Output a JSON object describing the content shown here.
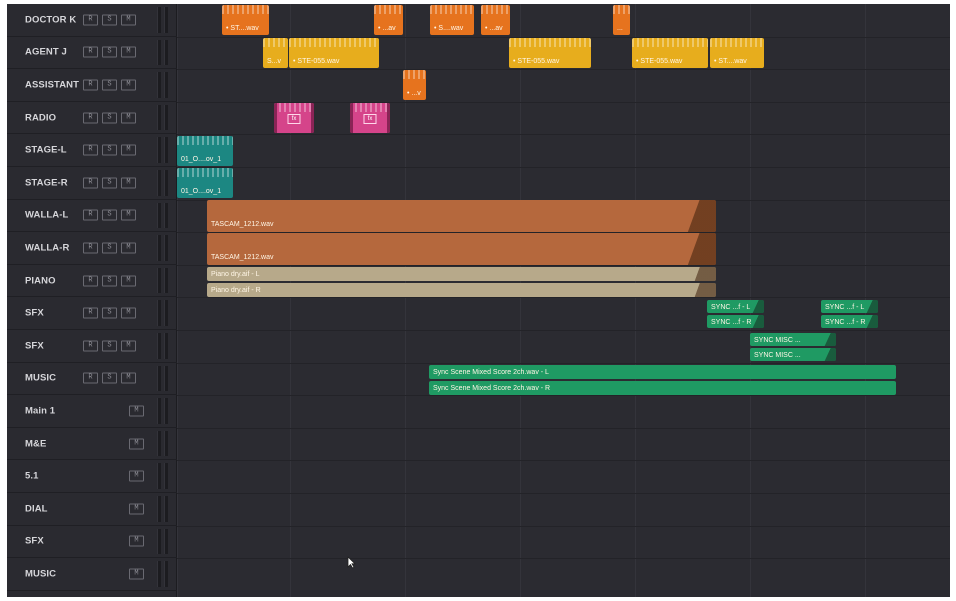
{
  "tracks": [
    {
      "name": "DOCTOR K",
      "buttons": [
        "R",
        "S",
        "M"
      ]
    },
    {
      "name": "AGENT J",
      "buttons": [
        "R",
        "S",
        "M"
      ]
    },
    {
      "name": "ASSISTANT",
      "buttons": [
        "R",
        "S",
        "M"
      ]
    },
    {
      "name": "RADIO",
      "buttons": [
        "R",
        "S",
        "M"
      ]
    },
    {
      "name": "STAGE-L",
      "buttons": [
        "R",
        "S",
        "M"
      ]
    },
    {
      "name": "STAGE-R",
      "buttons": [
        "R",
        "S",
        "M"
      ]
    },
    {
      "name": "WALLA-L",
      "buttons": [
        "R",
        "S",
        "M"
      ]
    },
    {
      "name": "WALLA-R",
      "buttons": [
        "R",
        "S",
        "M"
      ]
    },
    {
      "name": "PIANO",
      "buttons": [
        "R",
        "S",
        "M"
      ]
    },
    {
      "name": "SFX",
      "buttons": [
        "R",
        "S",
        "M"
      ]
    },
    {
      "name": "SFX",
      "buttons": [
        "R",
        "S",
        "M"
      ]
    },
    {
      "name": "MUSIC",
      "buttons": [
        "R",
        "S",
        "M"
      ]
    },
    {
      "name": "Main 1",
      "buttons": [
        "M"
      ]
    },
    {
      "name": "M&E",
      "buttons": [
        "M"
      ]
    },
    {
      "name": "5.1",
      "buttons": [
        "M"
      ]
    },
    {
      "name": "DIAL",
      "buttons": [
        "M"
      ]
    },
    {
      "name": "SFX",
      "buttons": [
        "M"
      ]
    },
    {
      "name": "MUSIC",
      "buttons": [
        "M"
      ]
    }
  ],
  "clips": {
    "doctor_k": [
      {
        "label": "• ST....wav",
        "color": "orange"
      },
      {
        "label": "• ...av",
        "color": "orange"
      },
      {
        "label": "• S....wav",
        "color": "orange"
      },
      {
        "label": "• ...av",
        "color": "orange"
      },
      {
        "label": "...",
        "color": "orange"
      }
    ],
    "agent_j": [
      {
        "label": "S...v",
        "color": "yellow"
      },
      {
        "label": "• STE-055.wav",
        "color": "yellow"
      },
      {
        "label": "• STE-055.wav",
        "color": "yellow"
      },
      {
        "label": "• STE-055.wav",
        "color": "yellow"
      },
      {
        "label": "• ST....wav",
        "color": "yellow"
      }
    ],
    "assistant": [
      {
        "label": "• ...v",
        "color": "orange"
      }
    ],
    "radio": [
      {
        "label": "fx",
        "color": "pink"
      },
      {
        "label": "fx",
        "color": "pink"
      }
    ],
    "stage_l": [
      {
        "label": "01_O....ov_1",
        "color": "teal"
      }
    ],
    "stage_r": [
      {
        "label": "01_O....ov_1",
        "color": "teal"
      }
    ],
    "walla_l": [
      {
        "label": "TASCAM_1212.wav",
        "color": "brown"
      }
    ],
    "walla_r": [
      {
        "label": "TASCAM_1212.wav",
        "color": "brown"
      }
    ],
    "piano": [
      {
        "label": "Piano dry.aif - L",
        "color": "tan"
      },
      {
        "label": "Piano dry.aif - R",
        "color": "tan"
      }
    ],
    "sfx1": [
      {
        "label": "SYNC ...f - L",
        "color": "green"
      },
      {
        "label": "SYNC ...f - R",
        "color": "green"
      },
      {
        "label": "SYNC ...f - L",
        "color": "green"
      },
      {
        "label": "SYNC ...f - R",
        "color": "green"
      }
    ],
    "sfx2": [
      {
        "label": "SYNC MISC ...",
        "color": "green"
      },
      {
        "label": "SYNC MISC ...",
        "color": "green"
      }
    ],
    "music": [
      {
        "label": "Sync Scene Mixed Score 2ch.wav - L",
        "color": "green"
      },
      {
        "label": "Sync Scene Mixed Score 2ch.wav - R",
        "color": "green"
      }
    ]
  },
  "colors": {
    "orange": "#e6731e",
    "yellow": "#e7ad1d",
    "pink": "#d5448a",
    "teal": "#1c8782",
    "brown": "#b5683d",
    "tan": "#b7a98a",
    "green": "#1f9a63",
    "background": "#28282e"
  },
  "icons": {
    "mouse_cursor": "cursor-arrow-icon",
    "fx": "fx-icon"
  }
}
